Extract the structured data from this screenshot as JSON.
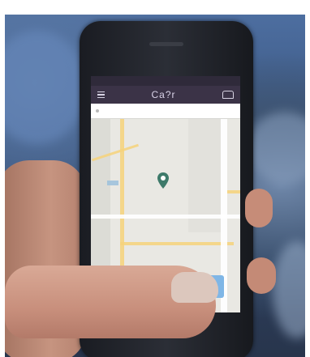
{
  "screen": {
    "status": {
      "carrier": "",
      "time": "",
      "battery": ""
    },
    "navbar": {
      "logo": "Ca?r",
      "menu_icon": "hamburger-icon",
      "right_icon": "car-icon"
    },
    "address": {
      "text": ""
    },
    "map": {
      "marker_icon": "location-pin-icon"
    }
  },
  "colors": {
    "navbar": "#3b3347",
    "map_bg": "#e9e8e3",
    "road": "#f6d27a",
    "button": "#7fb6e6"
  }
}
